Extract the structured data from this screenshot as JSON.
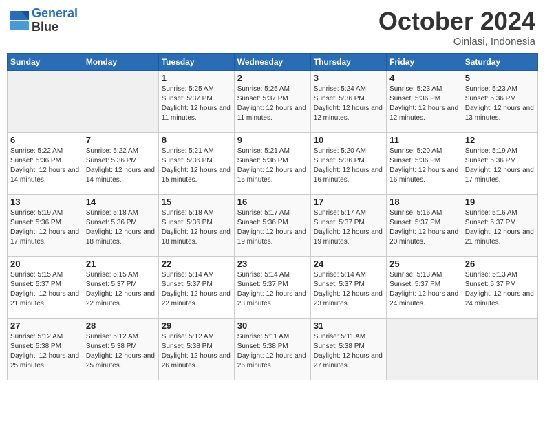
{
  "header": {
    "logo_line1": "General",
    "logo_line2": "Blue",
    "month": "October 2024",
    "location": "Oinlasi, Indonesia"
  },
  "weekdays": [
    "Sunday",
    "Monday",
    "Tuesday",
    "Wednesday",
    "Thursday",
    "Friday",
    "Saturday"
  ],
  "weeks": [
    [
      {
        "day": "",
        "info": ""
      },
      {
        "day": "",
        "info": ""
      },
      {
        "day": "1",
        "info": "Sunrise: 5:25 AM\nSunset: 5:37 PM\nDaylight: 12 hours and 11 minutes."
      },
      {
        "day": "2",
        "info": "Sunrise: 5:25 AM\nSunset: 5:37 PM\nDaylight: 12 hours and 11 minutes."
      },
      {
        "day": "3",
        "info": "Sunrise: 5:24 AM\nSunset: 5:36 PM\nDaylight: 12 hours and 12 minutes."
      },
      {
        "day": "4",
        "info": "Sunrise: 5:23 AM\nSunset: 5:36 PM\nDaylight: 12 hours and 12 minutes."
      },
      {
        "day": "5",
        "info": "Sunrise: 5:23 AM\nSunset: 5:36 PM\nDaylight: 12 hours and 13 minutes."
      }
    ],
    [
      {
        "day": "6",
        "info": "Sunrise: 5:22 AM\nSunset: 5:36 PM\nDaylight: 12 hours and 14 minutes."
      },
      {
        "day": "7",
        "info": "Sunrise: 5:22 AM\nSunset: 5:36 PM\nDaylight: 12 hours and 14 minutes."
      },
      {
        "day": "8",
        "info": "Sunrise: 5:21 AM\nSunset: 5:36 PM\nDaylight: 12 hours and 15 minutes."
      },
      {
        "day": "9",
        "info": "Sunrise: 5:21 AM\nSunset: 5:36 PM\nDaylight: 12 hours and 15 minutes."
      },
      {
        "day": "10",
        "info": "Sunrise: 5:20 AM\nSunset: 5:36 PM\nDaylight: 12 hours and 16 minutes."
      },
      {
        "day": "11",
        "info": "Sunrise: 5:20 AM\nSunset: 5:36 PM\nDaylight: 12 hours and 16 minutes."
      },
      {
        "day": "12",
        "info": "Sunrise: 5:19 AM\nSunset: 5:36 PM\nDaylight: 12 hours and 17 minutes."
      }
    ],
    [
      {
        "day": "13",
        "info": "Sunrise: 5:19 AM\nSunset: 5:36 PM\nDaylight: 12 hours and 17 minutes."
      },
      {
        "day": "14",
        "info": "Sunrise: 5:18 AM\nSunset: 5:36 PM\nDaylight: 12 hours and 18 minutes."
      },
      {
        "day": "15",
        "info": "Sunrise: 5:18 AM\nSunset: 5:36 PM\nDaylight: 12 hours and 18 minutes."
      },
      {
        "day": "16",
        "info": "Sunrise: 5:17 AM\nSunset: 5:36 PM\nDaylight: 12 hours and 19 minutes."
      },
      {
        "day": "17",
        "info": "Sunrise: 5:17 AM\nSunset: 5:37 PM\nDaylight: 12 hours and 19 minutes."
      },
      {
        "day": "18",
        "info": "Sunrise: 5:16 AM\nSunset: 5:37 PM\nDaylight: 12 hours and 20 minutes."
      },
      {
        "day": "19",
        "info": "Sunrise: 5:16 AM\nSunset: 5:37 PM\nDaylight: 12 hours and 21 minutes."
      }
    ],
    [
      {
        "day": "20",
        "info": "Sunrise: 5:15 AM\nSunset: 5:37 PM\nDaylight: 12 hours and 21 minutes."
      },
      {
        "day": "21",
        "info": "Sunrise: 5:15 AM\nSunset: 5:37 PM\nDaylight: 12 hours and 22 minutes."
      },
      {
        "day": "22",
        "info": "Sunrise: 5:14 AM\nSunset: 5:37 PM\nDaylight: 12 hours and 22 minutes."
      },
      {
        "day": "23",
        "info": "Sunrise: 5:14 AM\nSunset: 5:37 PM\nDaylight: 12 hours and 23 minutes."
      },
      {
        "day": "24",
        "info": "Sunrise: 5:14 AM\nSunset: 5:37 PM\nDaylight: 12 hours and 23 minutes."
      },
      {
        "day": "25",
        "info": "Sunrise: 5:13 AM\nSunset: 5:37 PM\nDaylight: 12 hours and 24 minutes."
      },
      {
        "day": "26",
        "info": "Sunrise: 5:13 AM\nSunset: 5:37 PM\nDaylight: 12 hours and 24 minutes."
      }
    ],
    [
      {
        "day": "27",
        "info": "Sunrise: 5:12 AM\nSunset: 5:38 PM\nDaylight: 12 hours and 25 minutes."
      },
      {
        "day": "28",
        "info": "Sunrise: 5:12 AM\nSunset: 5:38 PM\nDaylight: 12 hours and 25 minutes."
      },
      {
        "day": "29",
        "info": "Sunrise: 5:12 AM\nSunset: 5:38 PM\nDaylight: 12 hours and 26 minutes."
      },
      {
        "day": "30",
        "info": "Sunrise: 5:11 AM\nSunset: 5:38 PM\nDaylight: 12 hours and 26 minutes."
      },
      {
        "day": "31",
        "info": "Sunrise: 5:11 AM\nSunset: 5:38 PM\nDaylight: 12 hours and 27 minutes."
      },
      {
        "day": "",
        "info": ""
      },
      {
        "day": "",
        "info": ""
      }
    ]
  ]
}
